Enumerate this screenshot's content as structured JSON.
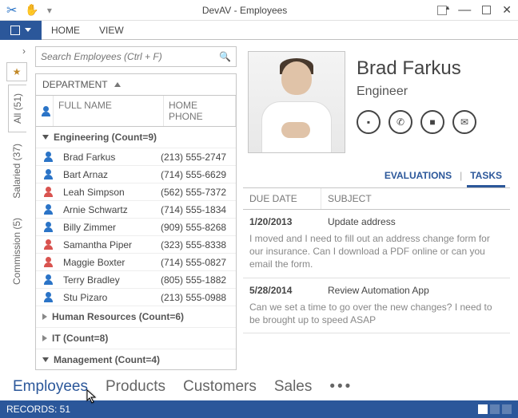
{
  "window": {
    "title": "DevAV - Employees"
  },
  "ribbon": {
    "file_icon": "square",
    "tabs": {
      "home": "HOME",
      "view": "VIEW"
    }
  },
  "sidebar": {
    "tabs": [
      {
        "id": "all",
        "label": "All (51)"
      },
      {
        "id": "salaried",
        "label": "Salaried (37)"
      },
      {
        "id": "commission",
        "label": "Commission (5)"
      }
    ]
  },
  "search": {
    "placeholder": "Search Employees (Ctrl + F)"
  },
  "grid": {
    "group_label": "DEPARTMENT",
    "columns": {
      "name": "FULL NAME",
      "phone": "HOME PHONE"
    },
    "groups": [
      {
        "title": "Engineering (Count=9)",
        "expanded": true,
        "rows": [
          {
            "name": "Brad Farkus",
            "phone": "(213) 555-2747",
            "c": "blue"
          },
          {
            "name": "Bart Arnaz",
            "phone": "(714) 555-6629",
            "c": "blue"
          },
          {
            "name": "Leah Simpson",
            "phone": "(562) 555-7372",
            "c": "red"
          },
          {
            "name": "Arnie Schwartz",
            "phone": "(714) 555-1834",
            "c": "blue"
          },
          {
            "name": "Billy Zimmer",
            "phone": "(909) 555-8268",
            "c": "blue"
          },
          {
            "name": "Samantha Piper",
            "phone": "(323) 555-8338",
            "c": "red"
          },
          {
            "name": "Maggie Boxter",
            "phone": "(714) 555-0827",
            "c": "red"
          },
          {
            "name": "Terry Bradley",
            "phone": "(805) 555-1882",
            "c": "blue"
          },
          {
            "name": "Stu Pizaro",
            "phone": "(213) 555-0988",
            "c": "blue"
          }
        ]
      },
      {
        "title": "Human Resources (Count=6)",
        "expanded": false,
        "rows": []
      },
      {
        "title": "IT (Count=8)",
        "expanded": false,
        "rows": []
      },
      {
        "title": "Management (Count=4)",
        "expanded": true,
        "rows": []
      }
    ]
  },
  "card": {
    "name": "Brad Farkus",
    "role": "Engineer"
  },
  "detail_tabs": {
    "eval": "EVALUATIONS",
    "tasks": "TASKS"
  },
  "task_columns": {
    "due": "DUE DATE",
    "subject": "SUBJECT"
  },
  "tasks": [
    {
      "date": "1/20/2013",
      "subject": "Update address",
      "desc": "I moved and I need to fill out an address change form for our insurance.  Can I download a PDF online or can you email the form."
    },
    {
      "date": "5/28/2014",
      "subject": "Review Automation App",
      "desc": "Can we set a time to go over the new changes?  I need to be brought up to speed ASAP"
    }
  ],
  "nav": {
    "employees": "Employees",
    "products": "Products",
    "customers": "Customers",
    "sales": "Sales"
  },
  "status": {
    "records": "RECORDS: 51"
  }
}
